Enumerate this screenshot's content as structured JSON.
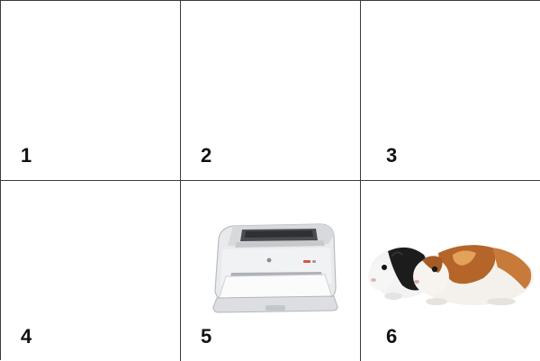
{
  "cells": [
    {
      "number": "1",
      "picture": ""
    },
    {
      "number": "2",
      "picture": ""
    },
    {
      "number": "3",
      "picture": ""
    },
    {
      "number": "4",
      "picture": ""
    },
    {
      "number": "5",
      "picture": "laser-printer"
    },
    {
      "number": "6",
      "picture": "guinea-pigs"
    }
  ]
}
